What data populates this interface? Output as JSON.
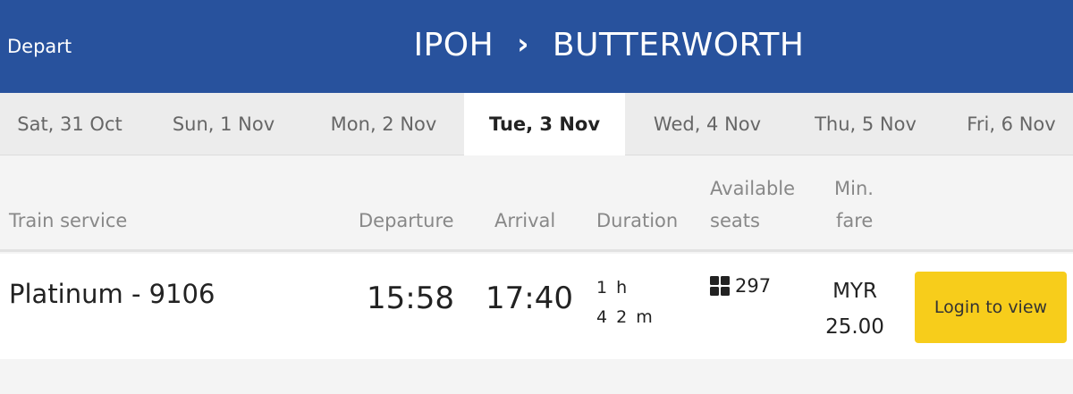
{
  "header": {
    "depart_label": "Depart",
    "origin": "IPOH",
    "arrow": "›",
    "destination": "BUTTERWORTH"
  },
  "date_tabs": [
    {
      "label": "Sat, 31 Oct",
      "active": false
    },
    {
      "label": "Sun, 1 Nov",
      "active": false
    },
    {
      "label": "Mon, 2 Nov",
      "active": false
    },
    {
      "label": "Tue, 3 Nov",
      "active": true
    },
    {
      "label": "Wed, 4 Nov",
      "active": false
    },
    {
      "label": "Thu, 5 Nov",
      "active": false
    },
    {
      "label": "Fri, 6 Nov",
      "active": false
    }
  ],
  "table": {
    "columns": {
      "service": "Train service",
      "departure": "Departure",
      "arrival": "Arrival",
      "duration": "Duration",
      "seats_line1": "Available",
      "seats_line2": "seats",
      "fare_line1": "Min.",
      "fare_line2": "fare"
    },
    "rows": [
      {
        "service": "Platinum - 9106",
        "departure": "15:58",
        "arrival": "17:40",
        "duration_line1": "1 h",
        "duration_line2": "4 2 m",
        "seats": "297",
        "seats_icon": "seat-grid-icon",
        "fare_currency": "MYR",
        "fare_amount": "25.00",
        "action_label": "Login to view"
      }
    ]
  },
  "colors": {
    "header_bg": "#28529d",
    "button_bg": "#f7cd1b"
  }
}
